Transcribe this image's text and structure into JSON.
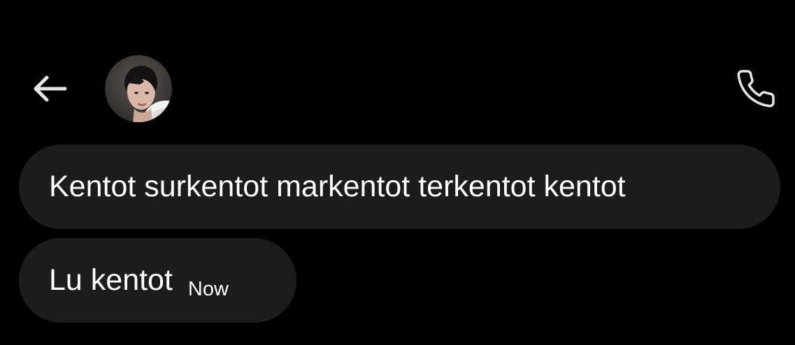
{
  "header": {
    "back_icon": "arrow-left-icon",
    "avatar_icon": "contact-avatar",
    "call_icon": "phone-icon"
  },
  "messages": [
    {
      "text": "Kentot surkentot markentot terkentot kentot",
      "time": ""
    },
    {
      "text": "Lu kentot",
      "time": "Now"
    }
  ],
  "colors": {
    "background": "#000000",
    "bubble": "#1c1c1e",
    "text": "#ffffff",
    "icon": "#e5e5e5"
  }
}
